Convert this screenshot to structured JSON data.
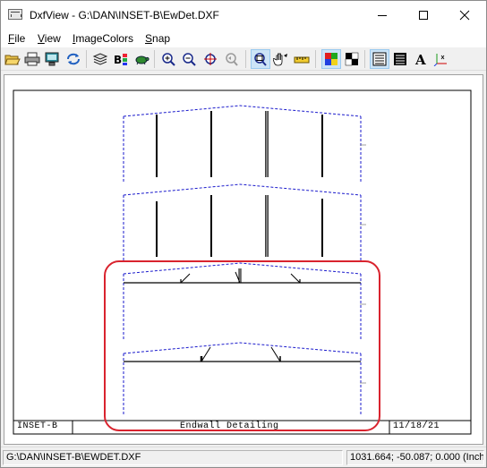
{
  "window": {
    "app_name": "DxfView",
    "title": "DxfView - G:\\DAN\\INSET-B\\EwDet.DXF"
  },
  "menu": [
    {
      "label": "File",
      "accel": "F",
      "rest": "ile"
    },
    {
      "label": "View",
      "accel": "V",
      "rest": "iew"
    },
    {
      "label": "ImageColors",
      "accel": "I",
      "rest": "mageColors"
    },
    {
      "label": "Snap",
      "accel": "S",
      "rest": "nap"
    }
  ],
  "toolbar": {
    "icons": [
      "open-folder-icon",
      "print-icon",
      "monitor-icon",
      "refresh-icon",
      "layers-icon",
      "blocks-icon",
      "turtle-icon",
      "zoom-in-icon",
      "zoom-out-icon",
      "zoom-window-icon",
      "zoom-previous-icon",
      "zoom-extents-icon",
      "pan-hand-icon",
      "measure-ruler-icon",
      "color-image-icon",
      "black-white-icon",
      "list-view-icon",
      "detail-view-icon",
      "text-style-icon",
      "axis-icon"
    ],
    "pressed": [
      "zoom-extents-icon",
      "color-image-icon",
      "list-view-icon"
    ]
  },
  "drawing": {
    "title_block": {
      "project": "INSET-B",
      "sheet_title": "Endwall Detailing",
      "date": "11/18/21"
    },
    "highlight_color": "#d9232e",
    "dashed_color": "#1a1acc",
    "line_color": "#000000"
  },
  "statusbar": {
    "file_path": "G:\\DAN\\INSET-B\\EWDET.DXF",
    "coordinates": "1031.664; -50.087; 0.000 (Inch"
  }
}
